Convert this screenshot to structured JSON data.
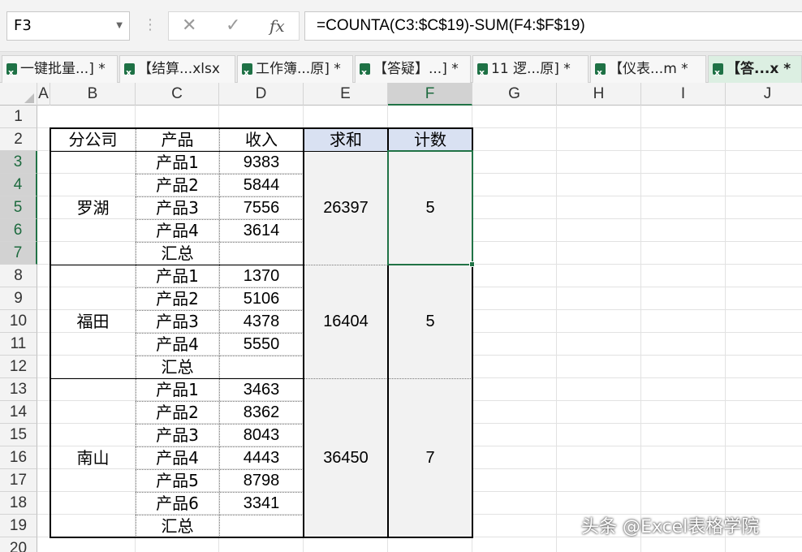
{
  "formula_bar": {
    "name_box": "F3",
    "cancel_icon": "✕",
    "enter_icon": "✓",
    "fx_label": "fx",
    "formula": "=COUNTA(C3:$C$19)-SUM(F4:$F$19)"
  },
  "tabs": [
    {
      "label": "一键批量...] *"
    },
    {
      "label": "【结算...xlsx"
    },
    {
      "label": "工作簿...原] *"
    },
    {
      "label": "【答疑】...] *"
    },
    {
      "label": "11 逻...原] *"
    },
    {
      "label": "【仪表...m *"
    },
    {
      "label": "【答...x *",
      "active": true
    }
  ],
  "columns": [
    "A",
    "B",
    "C",
    "D",
    "E",
    "F",
    "G",
    "H",
    "I",
    "J"
  ],
  "rows": [
    "1",
    "2",
    "3",
    "4",
    "5",
    "6",
    "7",
    "8",
    "9",
    "10",
    "11",
    "12",
    "13",
    "14",
    "15",
    "16",
    "17",
    "18",
    "19",
    "20"
  ],
  "table": {
    "headers": {
      "branch": "分公司",
      "product": "产品",
      "income": "收入",
      "sum": "求和",
      "count": "计数"
    },
    "groups": [
      {
        "branch": "罗湖",
        "rows": [
          {
            "product": "产品1",
            "income": "9383"
          },
          {
            "product": "产品2",
            "income": "5844"
          },
          {
            "product": "产品3",
            "income": "7556"
          },
          {
            "product": "产品4",
            "income": "3614"
          },
          {
            "product": "汇总",
            "income": ""
          }
        ],
        "sum": "26397",
        "count": "5"
      },
      {
        "branch": "福田",
        "rows": [
          {
            "product": "产品1",
            "income": "1370"
          },
          {
            "product": "产品2",
            "income": "5106"
          },
          {
            "product": "产品3",
            "income": "4378"
          },
          {
            "product": "产品4",
            "income": "5550"
          },
          {
            "product": "汇总",
            "income": ""
          }
        ],
        "sum": "16404",
        "count": "5"
      },
      {
        "branch": "南山",
        "rows": [
          {
            "product": "产品1",
            "income": "3463"
          },
          {
            "product": "产品2",
            "income": "8362"
          },
          {
            "product": "产品3",
            "income": "8043"
          },
          {
            "product": "产品4",
            "income": "4443"
          },
          {
            "product": "产品5",
            "income": "8798"
          },
          {
            "product": "产品6",
            "income": "3341"
          },
          {
            "product": "汇总",
            "income": ""
          }
        ],
        "sum": "36450",
        "count": "7"
      }
    ]
  },
  "selection": {
    "cell": "F3",
    "range": "F3:F7"
  },
  "watermark": "头条 @Excel表格学院"
}
